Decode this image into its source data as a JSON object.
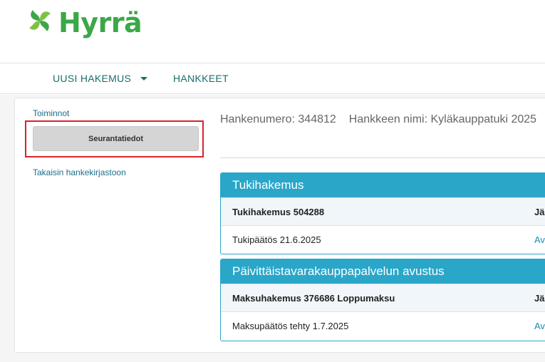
{
  "header": {
    "brand": "Hyrrä",
    "brand_color": "#3ba848",
    "logo_icon": "swirl-leaf-icon"
  },
  "nav": {
    "items": [
      {
        "label": "UUSI HAKEMUS",
        "has_dropdown": true
      },
      {
        "label": "HANKKEET"
      }
    ]
  },
  "sidebar": {
    "title": "Toiminnot",
    "action_button": "Seurantatiedot",
    "back_link": "Takaisin hankekirjastoon",
    "highlight_color": "#d9232a"
  },
  "project": {
    "number_label": "Hankenumero: 344812",
    "name_label": "Hankkeen nimi: Kyläkauppatuki 2025"
  },
  "panels": [
    {
      "title": "Tukihakemus",
      "rows": [
        {
          "text": "Tukihakemus 504288",
          "right": "Jä",
          "bold": true
        },
        {
          "text": "Tukipäätös 21.6.2025",
          "right": "Av",
          "bold": false
        }
      ]
    },
    {
      "title": "Päivittäistavarakauppapalvelun avustus",
      "rows": [
        {
          "text": "Maksuhakemus 376686 Loppumaksu",
          "right": "Jä",
          "bold": true
        },
        {
          "text": "Maksupäätös tehty 1.7.2025",
          "right": "Av",
          "bold": false
        }
      ]
    }
  ],
  "colors": {
    "accent": "#2aa6c9",
    "nav_text": "#1a6e6a",
    "link": "#1a6e8a"
  }
}
